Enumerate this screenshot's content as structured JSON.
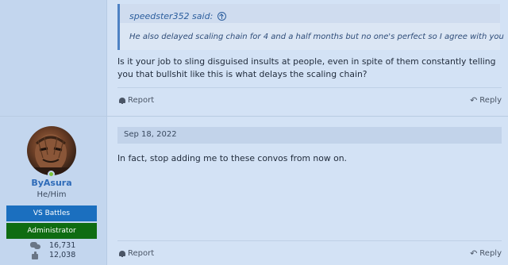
{
  "post1": {
    "quote": {
      "author": "speedster352 said:",
      "text": "He also delayed scaling chain for 4 and a half months but no one's perfect so I agree with you"
    },
    "message": "Is it your job to sling disguised insults at people, even in spite of them constantly telling you that bullshit like this is what delays the scaling chain?",
    "report_label": "Report",
    "reply_label": "Reply"
  },
  "post2": {
    "user": {
      "name": "ByAsura",
      "pronouns": "He/Him",
      "banners": [
        "VS Battles",
        "Administrator"
      ],
      "messages_count": "16,731",
      "reactions_count": "12,038"
    },
    "date": "Sep 18, 2022",
    "message": "In fact, stop adding me to these convos from now on.",
    "report_label": "Report",
    "reply_label": "Reply"
  },
  "icons": {
    "quote_jump": "arrow-circle-up-icon",
    "report": "bell-icon",
    "reply": "reply-icon",
    "messages": "chat-icon",
    "reactions": "thumbs-up-icon"
  },
  "colors": {
    "background": "#d3e2f5",
    "user_column": "#c3d6ee",
    "username": "#2e6bb8",
    "banner_vs": "#1b6fbf",
    "banner_admin": "#0f6c12",
    "quote_accent": "#4e82c4"
  }
}
